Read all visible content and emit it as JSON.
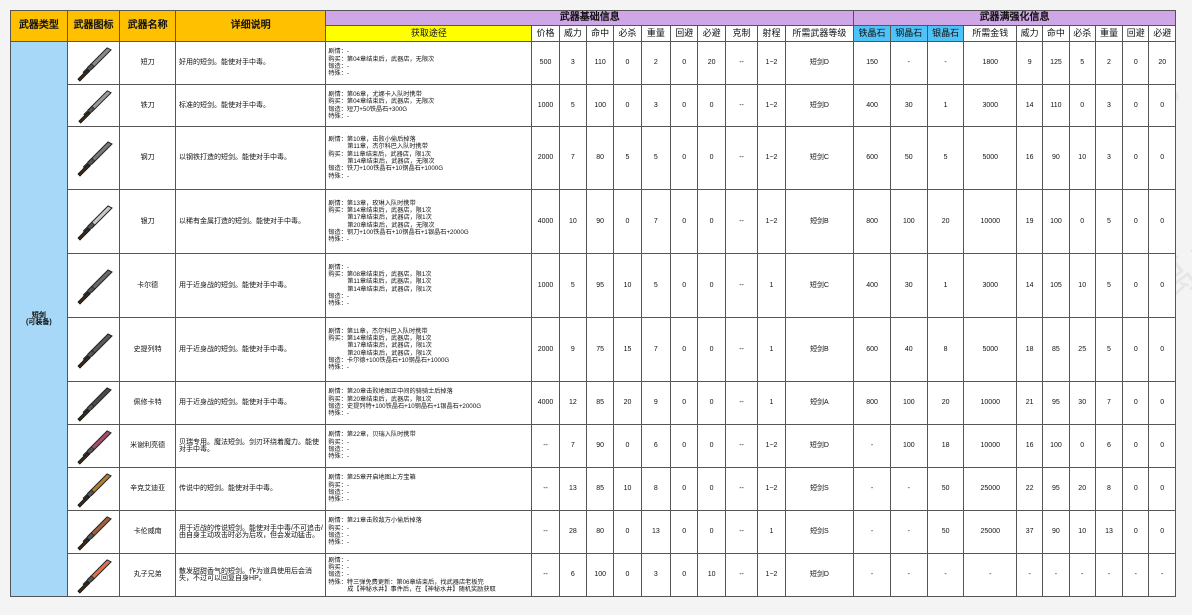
{
  "watermark": [
    "工具人UP江离之辉 禁止转载",
    "工具人UP江离之辉 禁止转载",
    "工具人UP江离之辉 禁止转载",
    "工具人UP江离之辉 禁止转载"
  ],
  "headers": {
    "type": "武器类型",
    "icon": "武器图标",
    "name": "武器名称",
    "desc": "详细说明",
    "base_group": "武器基础信息",
    "strong_group": "武器满强化信息",
    "source": "获取途径",
    "base_cols": [
      "价格",
      "威力",
      "命中",
      "必杀",
      "重量",
      "回避",
      "必避",
      "克制",
      "射程",
      "所需武器等级"
    ],
    "strong_cols": [
      "铁晶石",
      "钢晶石",
      "银晶石",
      "所需金钱",
      "威力",
      "命中",
      "必杀",
      "重量",
      "回避",
      "必避"
    ]
  },
  "weapon_type": "短剑\n(可装备)",
  "weapons": [
    {
      "name": "短刀",
      "desc": "好用的短剑。能使对手中毒。",
      "icon_color": "#8a8a8a",
      "source": "剧情：-\n购买：第04章结束后，武器店，无限次\n锻造：-\n特殊：-",
      "base": [
        "500",
        "3",
        "110",
        "0",
        "2",
        "0",
        "20",
        "--",
        "1~2",
        "短剑D"
      ],
      "strong": [
        "150",
        "-",
        "-",
        "1800",
        "9",
        "125",
        "5",
        "2",
        "0",
        "20"
      ]
    },
    {
      "name": "铁刀",
      "desc": "标准的短剑。能使对手中毒。",
      "icon_color": "#9a9a9a",
      "source": "剧情：第06章，尤娜卡入队时携带\n购买：第04章结束后，武器店，无限次\n锻造：短刀+50铁晶石+300G\n特殊：-",
      "base": [
        "1000",
        "5",
        "100",
        "0",
        "3",
        "0",
        "0",
        "--",
        "1~2",
        "短剑D"
      ],
      "strong": [
        "400",
        "30",
        "1",
        "3000",
        "14",
        "110",
        "0",
        "3",
        "0",
        "0"
      ]
    },
    {
      "name": "钢刀",
      "desc": "以钢铁打造的短剑。能使对手中毒。",
      "icon_color": "#7a7a7a",
      "source": "剧情：第10章，击败小偷后掉落\n           第11章，杰尔科巴入队时携带\n购买：第11章结束后，武器店，限1次\n           第14章结束后，武器店，无限次\n锻造：铁刀+100铁晶石+10钢晶石+1000G\n特殊：-",
      "base": [
        "2000",
        "7",
        "80",
        "5",
        "5",
        "0",
        "0",
        "--",
        "1~2",
        "短剑C"
      ],
      "strong": [
        "600",
        "50",
        "5",
        "5000",
        "16",
        "90",
        "10",
        "3",
        "0",
        "0"
      ]
    },
    {
      "name": "银刀",
      "desc": "以稀有金属打造的短剑。能使对手中毒。",
      "icon_color": "#c8c8c8",
      "source": "剧情：第13章，玫琳入队时携带\n购买：第14章结束后，武器店，限1次\n           第17章结束后，武器店，限1次\n           第20章结束后，武器店，无限次\n锻造：钢刀+100铁晶石+10钢晶石+1银晶石+2000G\n特殊：-",
      "base": [
        "4000",
        "10",
        "90",
        "0",
        "7",
        "0",
        "0",
        "--",
        "1~2",
        "短剑B"
      ],
      "strong": [
        "800",
        "100",
        "20",
        "10000",
        "19",
        "100",
        "0",
        "5",
        "0",
        "0"
      ]
    },
    {
      "name": "卡尔德",
      "desc": "用于近身战的短剑。能使对手中毒。",
      "icon_color": "#6a6a6a",
      "source": "剧情：-\n购买：第08章结束后，武器店，限1次\n           第11章结束后，武器店，限1次\n           第14章结束后，武器店，限1次\n锻造：-\n特殊：-",
      "base": [
        "1000",
        "5",
        "95",
        "10",
        "5",
        "0",
        "0",
        "--",
        "1",
        "短剑C"
      ],
      "strong": [
        "400",
        "30",
        "1",
        "3000",
        "14",
        "105",
        "10",
        "5",
        "0",
        "0"
      ]
    },
    {
      "name": "史提列特",
      "desc": "用于近身战的短剑。能使对手中毒。",
      "icon_color": "#5a5a5a",
      "source": "剧情：第11章，杰尔科巴入队时携带\n购买：第14章结束后，武器店，限1次\n           第17章结束后，武器店，限1次\n           第20章结束后，武器店，限1次\n锻造：卡尔德+100铁晶石+10钢晶石+1000G\n特殊：-",
      "base": [
        "2000",
        "9",
        "75",
        "15",
        "7",
        "0",
        "0",
        "--",
        "1",
        "短剑B"
      ],
      "strong": [
        "600",
        "40",
        "8",
        "5000",
        "18",
        "85",
        "25",
        "5",
        "0",
        "0"
      ]
    },
    {
      "name": "佩修卡特",
      "desc": "用于近身战的短剑。能使对手中毒。",
      "icon_color": "#4a4a4a",
      "source": "剧情：第20章击败地图正中间的骑骑士后掉落\n购买：第20章结束后，武器店，限1次\n锻造：史提列特+100铁晶石+10钢晶石+1银晶石+2000G\n特殊：-",
      "base": [
        "4000",
        "12",
        "85",
        "20",
        "9",
        "0",
        "0",
        "--",
        "1",
        "短剑A"
      ],
      "strong": [
        "800",
        "100",
        "20",
        "10000",
        "21",
        "95",
        "30",
        "7",
        "0",
        "0"
      ]
    },
    {
      "name": "米谢利亮德",
      "desc": "贝瑞专用。魔法短剑。剑刃环绕着魔力。能使对手中毒。",
      "icon_color": "#a0506a",
      "source": "剧情：第22章，贝瑞入队时携带\n购买：-\n锻造：-\n特殊：-",
      "base": [
        "--",
        "7",
        "90",
        "0",
        "6",
        "0",
        "0",
        "--",
        "1~2",
        "短剑D"
      ],
      "strong": [
        "-",
        "100",
        "18",
        "10000",
        "16",
        "100",
        "0",
        "6",
        "0",
        "0"
      ]
    },
    {
      "name": "辛克艾迪亚",
      "desc": "传说中的短剑。能使对手中毒。",
      "icon_color": "#b08030",
      "source": "剧情：第25章开启地图上方宝箱\n购买：-\n锻造：-\n特殊：-",
      "base": [
        "--",
        "13",
        "85",
        "10",
        "8",
        "0",
        "0",
        "--",
        "1~2",
        "短剑S"
      ],
      "strong": [
        "-",
        "-",
        "50",
        "25000",
        "22",
        "95",
        "20",
        "8",
        "0",
        "0"
      ]
    },
    {
      "name": "卡伦威南",
      "desc": "用于近战的传说短剑。能使对手中毒/不可追击/由自身主动攻击时必为后攻，但会发动猛击。",
      "icon_color": "#a06040",
      "source": "剧情：第21章击败敌方小偷后掉落\n购买：-\n锻造：-\n特殊：-",
      "base": [
        "--",
        "28",
        "80",
        "0",
        "13",
        "0",
        "0",
        "--",
        "1",
        "短剑S"
      ],
      "strong": [
        "-",
        "-",
        "50",
        "25000",
        "37",
        "90",
        "10",
        "13",
        "0",
        "0"
      ]
    },
    {
      "name": "丸子兄弟",
      "desc": "散发甜甜香气的短剑。作为道具使用后会消失，不过可以回复自身HP。",
      "icon_color": "#e07050",
      "source": "剧情：-\n购买：-\n锻造：-\n特殊：特三弹免费更新：第06章结束后，找武器店老板完\n           成【神秘水井】事件后，在【神秘水井】随机奖励获取",
      "base": [
        "--",
        "6",
        "100",
        "0",
        "3",
        "0",
        "10",
        "--",
        "1~2",
        "短剑D"
      ],
      "strong": [
        "-",
        "-",
        "-",
        "-",
        "-",
        "-",
        "-",
        "-",
        "-",
        "-"
      ]
    }
  ]
}
